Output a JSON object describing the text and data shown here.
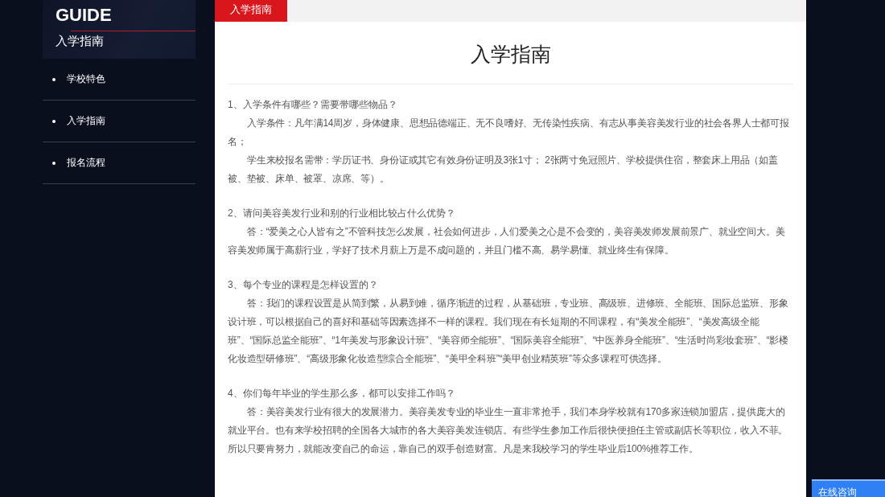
{
  "sidebar": {
    "banner": {
      "title": "GUIDE",
      "subtitle": "入学指南"
    },
    "items": [
      {
        "label": "学校特色"
      },
      {
        "label": "入学指南"
      },
      {
        "label": "报名流程"
      }
    ]
  },
  "content": {
    "tabs": [
      {
        "label": "入学指南",
        "selected": true
      }
    ],
    "title": "入学指南",
    "sections": [
      {
        "question": "1、入学条件有哪些？需要带哪些物品？",
        "answers": [
          "入学条件：凡年满14周岁，身体健康、思想品德端正、无不良嗜好、无传染性疾病、有志从事美容美发行业的社会各界人士都可报名；",
          "学生来校报名需带：学历证书、身份证或其它有效身份证明及3张1寸； 2张两寸免冠照片、学校提供住宿，整套床上用品（如盖被、垫被、床单、被罩、凉席、等）。"
        ]
      },
      {
        "question": "2、请问美容美发行业和别的行业相比较占什么优势？",
        "answers": [
          "答：“爱美之心人皆有之”不管科技怎么发展，社会如何进步，人们爱美之心是不会变的，美容美发师发展前景广、就业空间大。美容美发师属于高薪行业，学好了技术月薪上万是不成问题的，并且门槛不高、易学易懂、就业终生有保障。"
        ]
      },
      {
        "question": "3、每个专业的课程是怎样设置的？",
        "answers": [
          "答：我们的课程设置是从简到繁，从易到难，循序渐进的过程，从基础班，专业班、高级班、进修班、全能班、国际总监班、形象设计班，可以根据自己的喜好和基础等因素选择不一样的课程。我们现在有长短期的不同课程，有“美发全能班”、“美发高级全能班”、“国际总监全能班”、“1年美发与形象设计班”、“美容师全能班”、“国际美容全能班”、“中医养身全能班”、“生活时尚彩妆套班”、“影楼化妆造型研修班”、“高级形象化妆造型综合全能班”、“美甲全科班”“美甲创业精英班”等众多课程可供选择。"
        ]
      },
      {
        "question": "4、你们每年毕业的学生那么多，都可以安排工作吗？",
        "answers": [
          "答：美容美发行业有很大的发展潜力。美容美发专业的毕业生一直非常抢手，我们本身学校就有170多家连锁加盟店，提供庞大的就业平台。也有来学校招聘的全国各大城市的各大美容美发连锁店。有些学生参加工作后很快便担任主管或副店长等职位，收入不菲。所以只要肯努力，就能改变自己的命运，靠自己的双手创造财富。凡是来我校学习的学生毕业后100%推荐工作。"
        ]
      }
    ]
  },
  "chat_button": {
    "label": "在线咨询"
  }
}
